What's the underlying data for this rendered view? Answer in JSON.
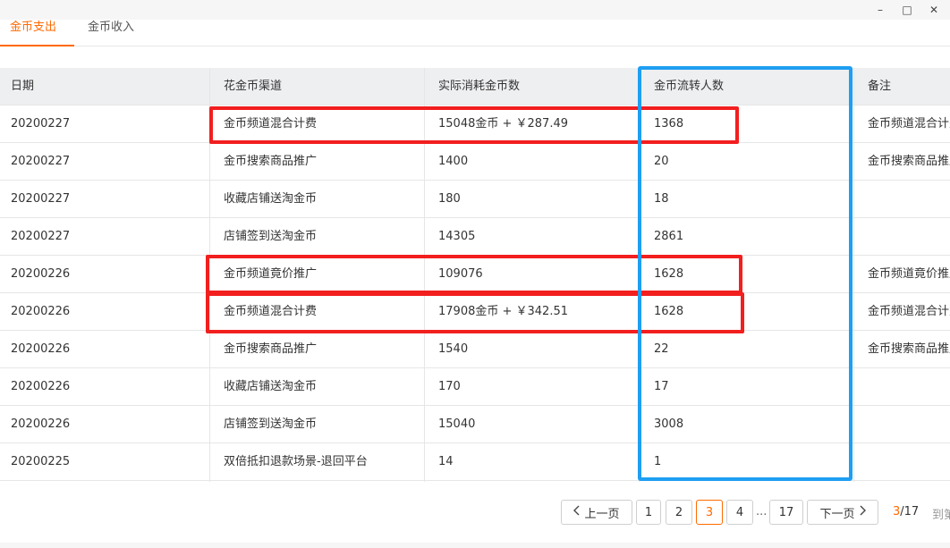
{
  "window": {
    "minimize_glyph": "–",
    "maximize_glyph": "□",
    "close_glyph": "✕"
  },
  "tabs": [
    {
      "label": "金币支出",
      "active": true
    },
    {
      "label": "金币收入",
      "active": false
    }
  ],
  "table": {
    "columns": [
      "日期",
      "花金币渠道",
      "实际消耗金币数",
      "金币流转人数",
      "备注"
    ],
    "rows": [
      [
        "20200227",
        "金币频道混合计费",
        "15048金币 + ￥287.49",
        "1368",
        "金币频道混合计费"
      ],
      [
        "20200227",
        "金币搜索商品推广",
        "1400",
        "20",
        "金币搜索商品推广"
      ],
      [
        "20200227",
        "收藏店铺送淘金币",
        "180",
        "18",
        ""
      ],
      [
        "20200227",
        "店铺签到送淘金币",
        "14305",
        "2861",
        ""
      ],
      [
        "20200226",
        "金币频道竟价推广",
        "109076",
        "1628",
        "金币频道竟价推广"
      ],
      [
        "20200226",
        "金币频道混合计费",
        "17908金币 + ￥342.51",
        "1628",
        "金币频道混合计费"
      ],
      [
        "20200226",
        "金币搜索商品推广",
        "1540",
        "22",
        "金币搜索商品推广"
      ],
      [
        "20200226",
        "收藏店铺送淘金币",
        "170",
        "17",
        ""
      ],
      [
        "20200226",
        "店铺签到送淘金币",
        "15040",
        "3008",
        ""
      ],
      [
        "20200225",
        "双倍抵扣退款场景-退回平台",
        "14",
        "1",
        ""
      ]
    ]
  },
  "pagination": {
    "prev_label": "上一页",
    "next_label": "下一页",
    "pages": [
      "1",
      "2",
      "3",
      "4"
    ],
    "ellipsis": "...",
    "last_page": "17",
    "current_page": "3",
    "total_pages": "/17",
    "jump_label": "到第"
  },
  "colors": {
    "accent": "#ff6a00",
    "highlight_red": "#f21f1f",
    "highlight_blue": "#1e9ff2"
  }
}
